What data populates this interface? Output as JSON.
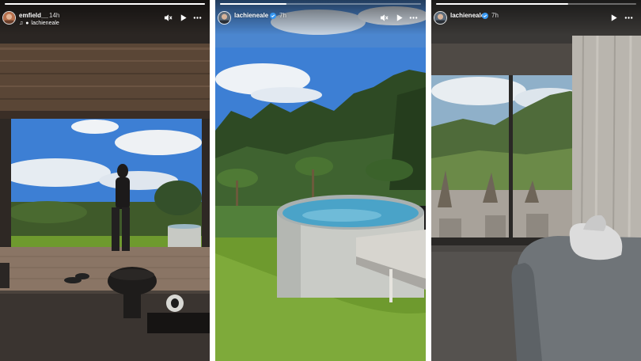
{
  "stories": [
    {
      "username": "emfield__",
      "time": "14h",
      "collab_user": "lachieneale",
      "progress_fraction": 1.0,
      "controls": [
        "mute-icon",
        "play-icon",
        "more-icon"
      ]
    },
    {
      "username": "lachieneale",
      "time": "7h",
      "verified": true,
      "progress_fraction": 0.33,
      "controls": [
        "mute-icon",
        "play-icon",
        "more-icon"
      ]
    },
    {
      "username": "lachieneale",
      "time": "7h",
      "verified": true,
      "progress_fraction": 0.66,
      "controls": [
        "play-icon",
        "more-icon"
      ]
    }
  ],
  "colors": {
    "sky_blue": "#3d7fd4",
    "grass_green": "#6e9a2e",
    "pool_water": "#4aa3c8",
    "verified_blue": "#3897f0"
  }
}
